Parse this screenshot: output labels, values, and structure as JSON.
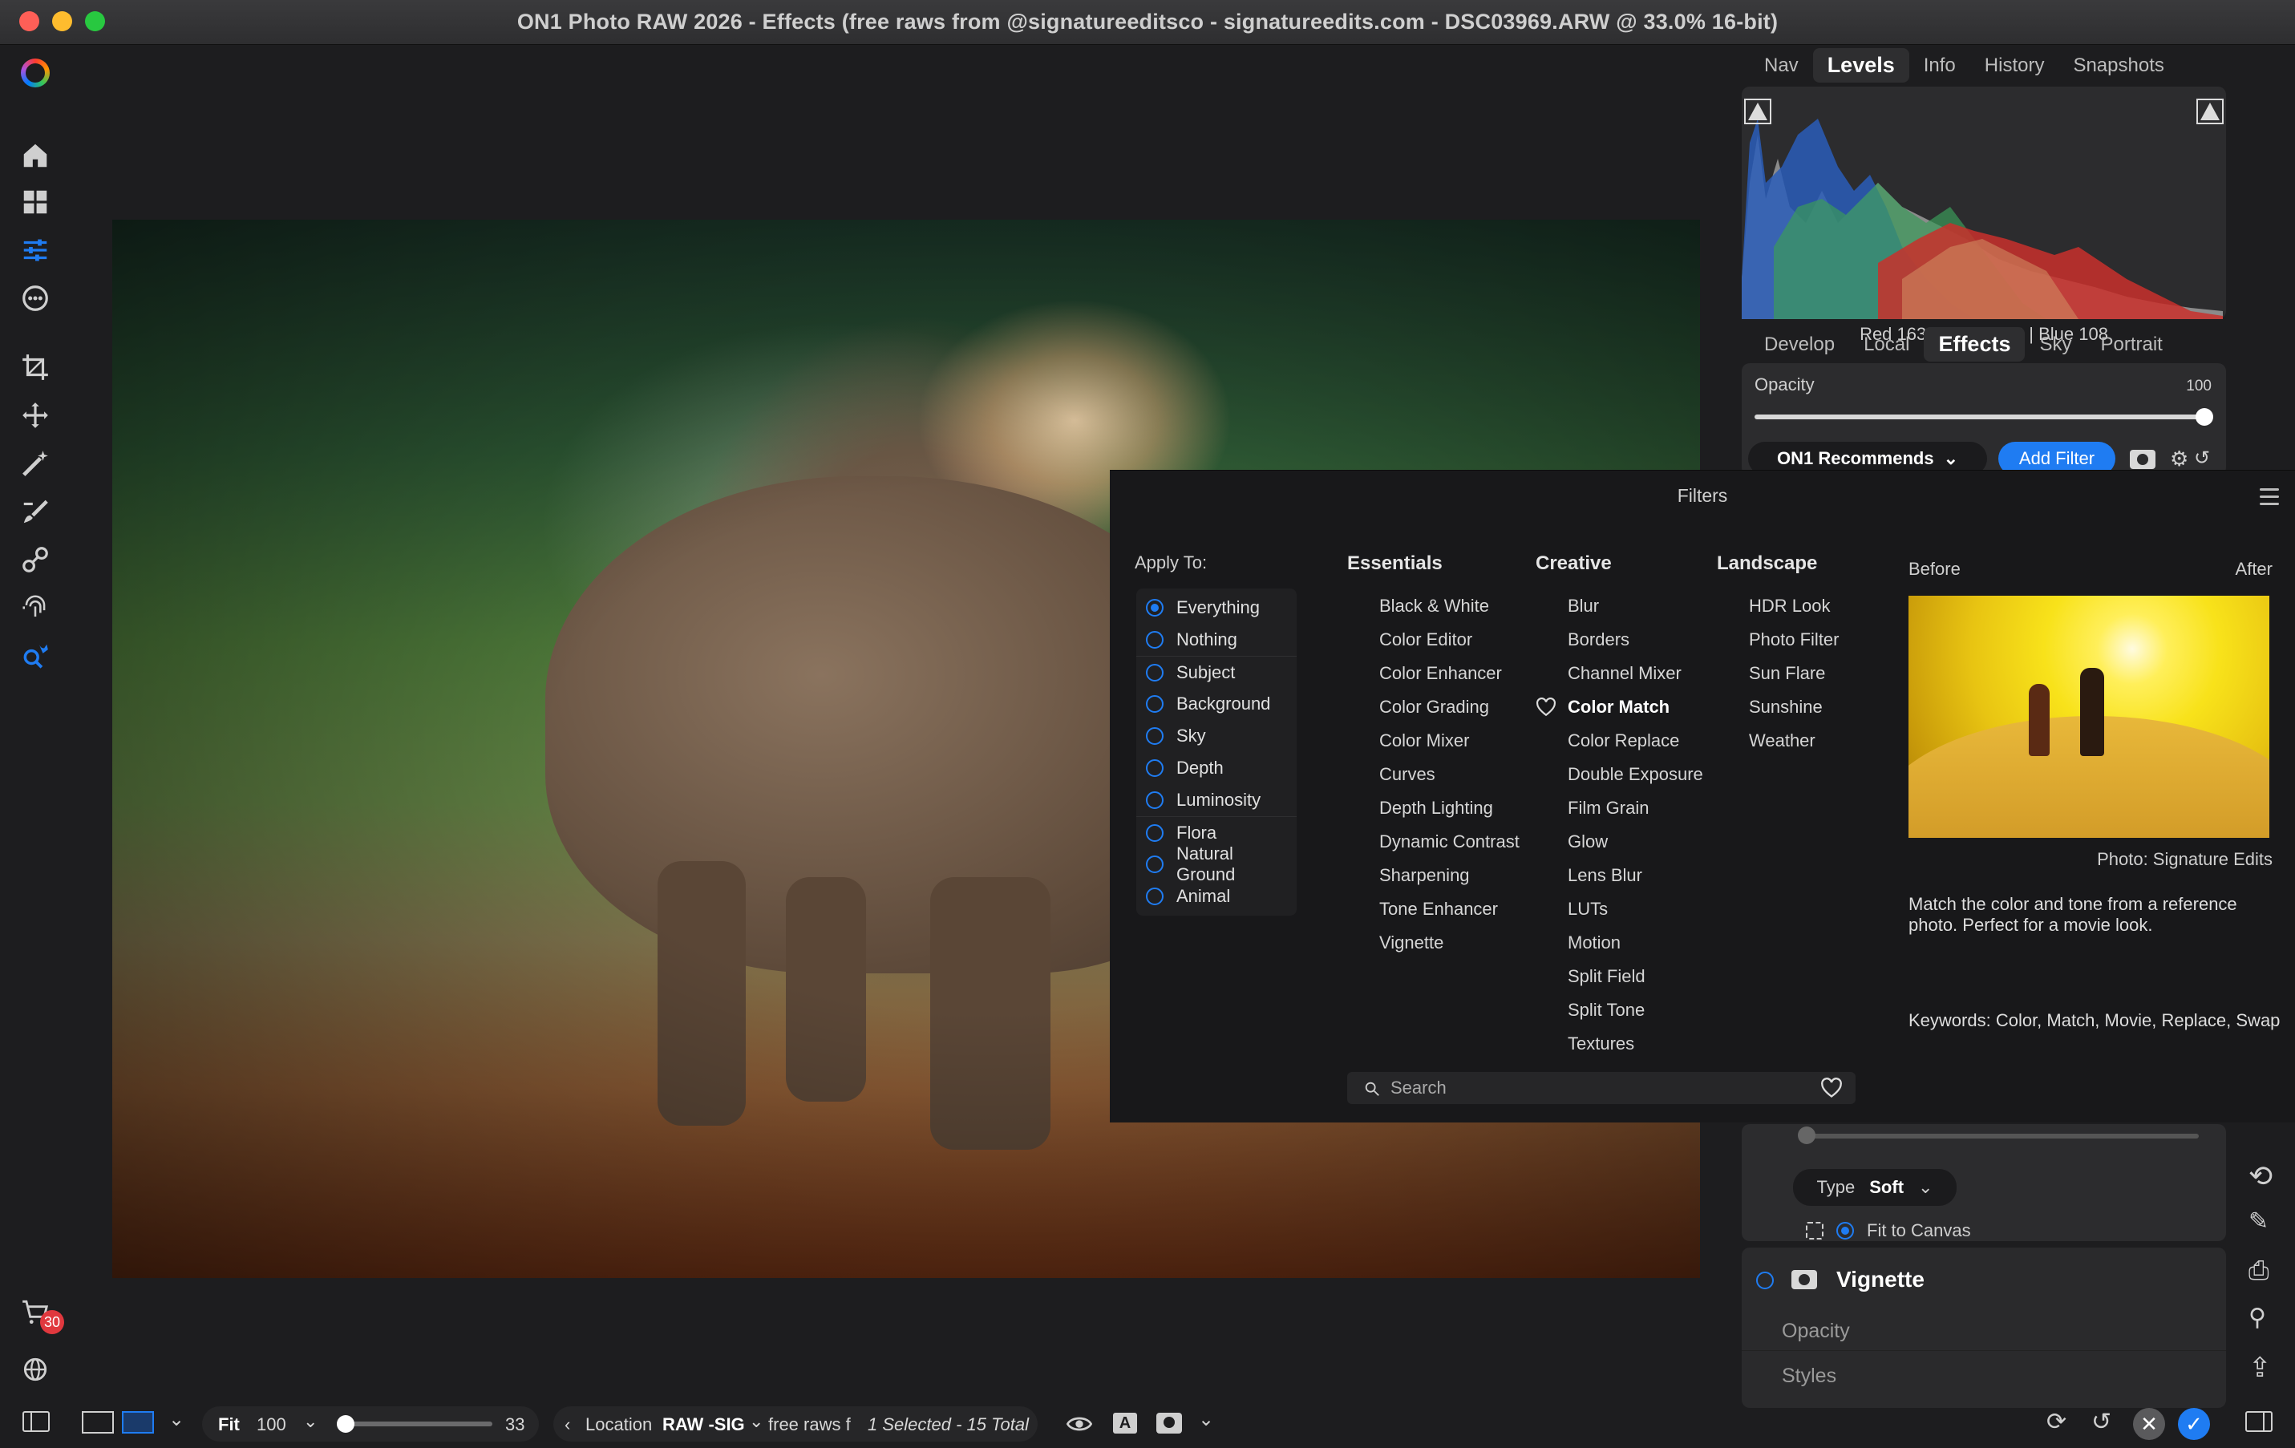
{
  "window": {
    "title": "ON1 Photo RAW 2026 - Effects (free raws from @signatureeditsco - signatureedits.com - DSC03969.ARW @ 33.0% 16-bit)"
  },
  "left_toolbar": {
    "icons": [
      "home-icon",
      "grid-icon",
      "sliders-icon",
      "more-icon",
      "crop-icon",
      "transform-icon",
      "wand-icon",
      "brush-icon",
      "clone-icon",
      "portrait-icon",
      "search-person-icon",
      "cart-icon",
      "sync-icon"
    ],
    "cart_badge": "30"
  },
  "top_tabs": [
    {
      "label": "Nav",
      "active": false
    },
    {
      "label": "Levels",
      "active": true
    },
    {
      "label": "Info",
      "active": false
    },
    {
      "label": "History",
      "active": false
    },
    {
      "label": "Snapshots",
      "active": false
    }
  ],
  "histogram": {
    "readout": "Red 163 | Green 153 | Blue 108"
  },
  "module_tabs": [
    {
      "label": "Develop",
      "active": false
    },
    {
      "label": "Local",
      "active": false
    },
    {
      "label": "Effects",
      "active": true
    },
    {
      "label": "Sky",
      "active": false
    },
    {
      "label": "Portrait",
      "active": false
    }
  ],
  "opacity": {
    "label": "Opacity",
    "value": "100",
    "level": 1.0
  },
  "filter_controls": {
    "recommends_label": "ON1 Recommends",
    "add_filter_label": "Add Filter"
  },
  "filters_panel": {
    "title": "Filters",
    "apply_to": {
      "heading": "Apply To:",
      "options": [
        "Everything",
        "Nothing",
        "Subject",
        "Background",
        "Sky",
        "Depth",
        "Luminosity",
        "Flora",
        "Natural Ground",
        "Animal"
      ],
      "selected": "Everything"
    },
    "categories": [
      {
        "heading": "Essentials",
        "items": [
          "Black & White",
          "Color Editor",
          "Color Enhancer",
          "Color Grading",
          "Color Mixer",
          "Curves",
          "Depth Lighting",
          "Dynamic Contrast",
          "Sharpening",
          "Tone Enhancer",
          "Vignette"
        ]
      },
      {
        "heading": "Creative",
        "items": [
          "Blur",
          "Borders",
          "Channel Mixer",
          "Color Match",
          "Color Replace",
          "Double Exposure",
          "Film Grain",
          "Glow",
          "Lens Blur",
          "LUTs",
          "Motion",
          "Split Field",
          "Split Tone",
          "Textures"
        ]
      },
      {
        "heading": "Landscape",
        "items": [
          "HDR Look",
          "Photo Filter",
          "Sun Flare",
          "Sunshine",
          "Weather"
        ]
      }
    ],
    "selected_filter": "Color Match",
    "search_placeholder": "Search",
    "preview": {
      "before_label": "Before",
      "after_label": "After",
      "credit": "Photo: Signature Edits",
      "description": "Match the color and tone from a reference photo. Perfect for a movie look.",
      "keywords": "Keywords: Color, Match, Movie, Replace, Swap"
    }
  },
  "type_row": {
    "type_label": "Type",
    "type_value": "Soft",
    "fit_label": "Fit to Canvas"
  },
  "vignette_section": {
    "title": "Vignette",
    "opacity_label": "Opacity",
    "styles_label": "Styles"
  },
  "bottom_bar": {
    "fit_label": "Fit",
    "zoom_value": "100",
    "thumb_size": "33",
    "thumb_level": 0.0,
    "location_label": "Location",
    "path_segment": "RAW -SIG",
    "path_segment2": "free raws f",
    "selection": "1 Selected - 15 Total"
  },
  "colors": {
    "accent": "#1f7cf2",
    "background": "#1d1d1f",
    "panel": "#2c2c2e",
    "overlay": "#18181a"
  }
}
